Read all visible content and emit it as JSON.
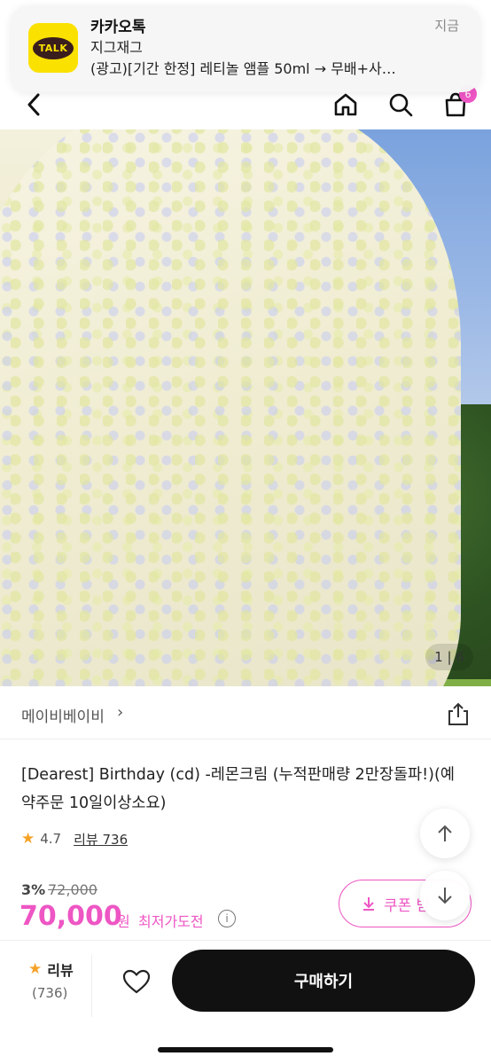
{
  "notification": {
    "app_name": "카카오톡",
    "time": "지금",
    "sender": "지그재그",
    "message": "(광고)[기간 한정] 레티놀 앰플 50ml → 무배+사…",
    "logo_text": "TALK"
  },
  "top_nav": {
    "icons": [
      "back-icon",
      "home-icon",
      "search-icon",
      "cart-icon"
    ],
    "cart_badge": "6"
  },
  "gallery": {
    "counter": "1 | 6"
  },
  "brand": {
    "name": "메이비베이비",
    "chevron": "›"
  },
  "product": {
    "title": "[Dearest] Birthday (cd) -레몬크림 (누적판매량 2만장돌파!)(예약주문 10일이상소요)",
    "rating": "4.7",
    "review_link": "리뷰 736"
  },
  "price": {
    "discount_rate": "3%",
    "original": "72,000",
    "sale": "70,000",
    "unit": "원",
    "lowest_label": "최저가도전",
    "info_icon": "i"
  },
  "coupon": {
    "label": "쿠폰 받"
  },
  "bottom_bar": {
    "review_label": "리뷰",
    "review_count": "(736)",
    "buy_label": "구매하기"
  },
  "colors": {
    "accent": "#ee56c4",
    "kakao_yellow": "#fae100",
    "star": "#f4a226",
    "buy_button": "#111111"
  }
}
